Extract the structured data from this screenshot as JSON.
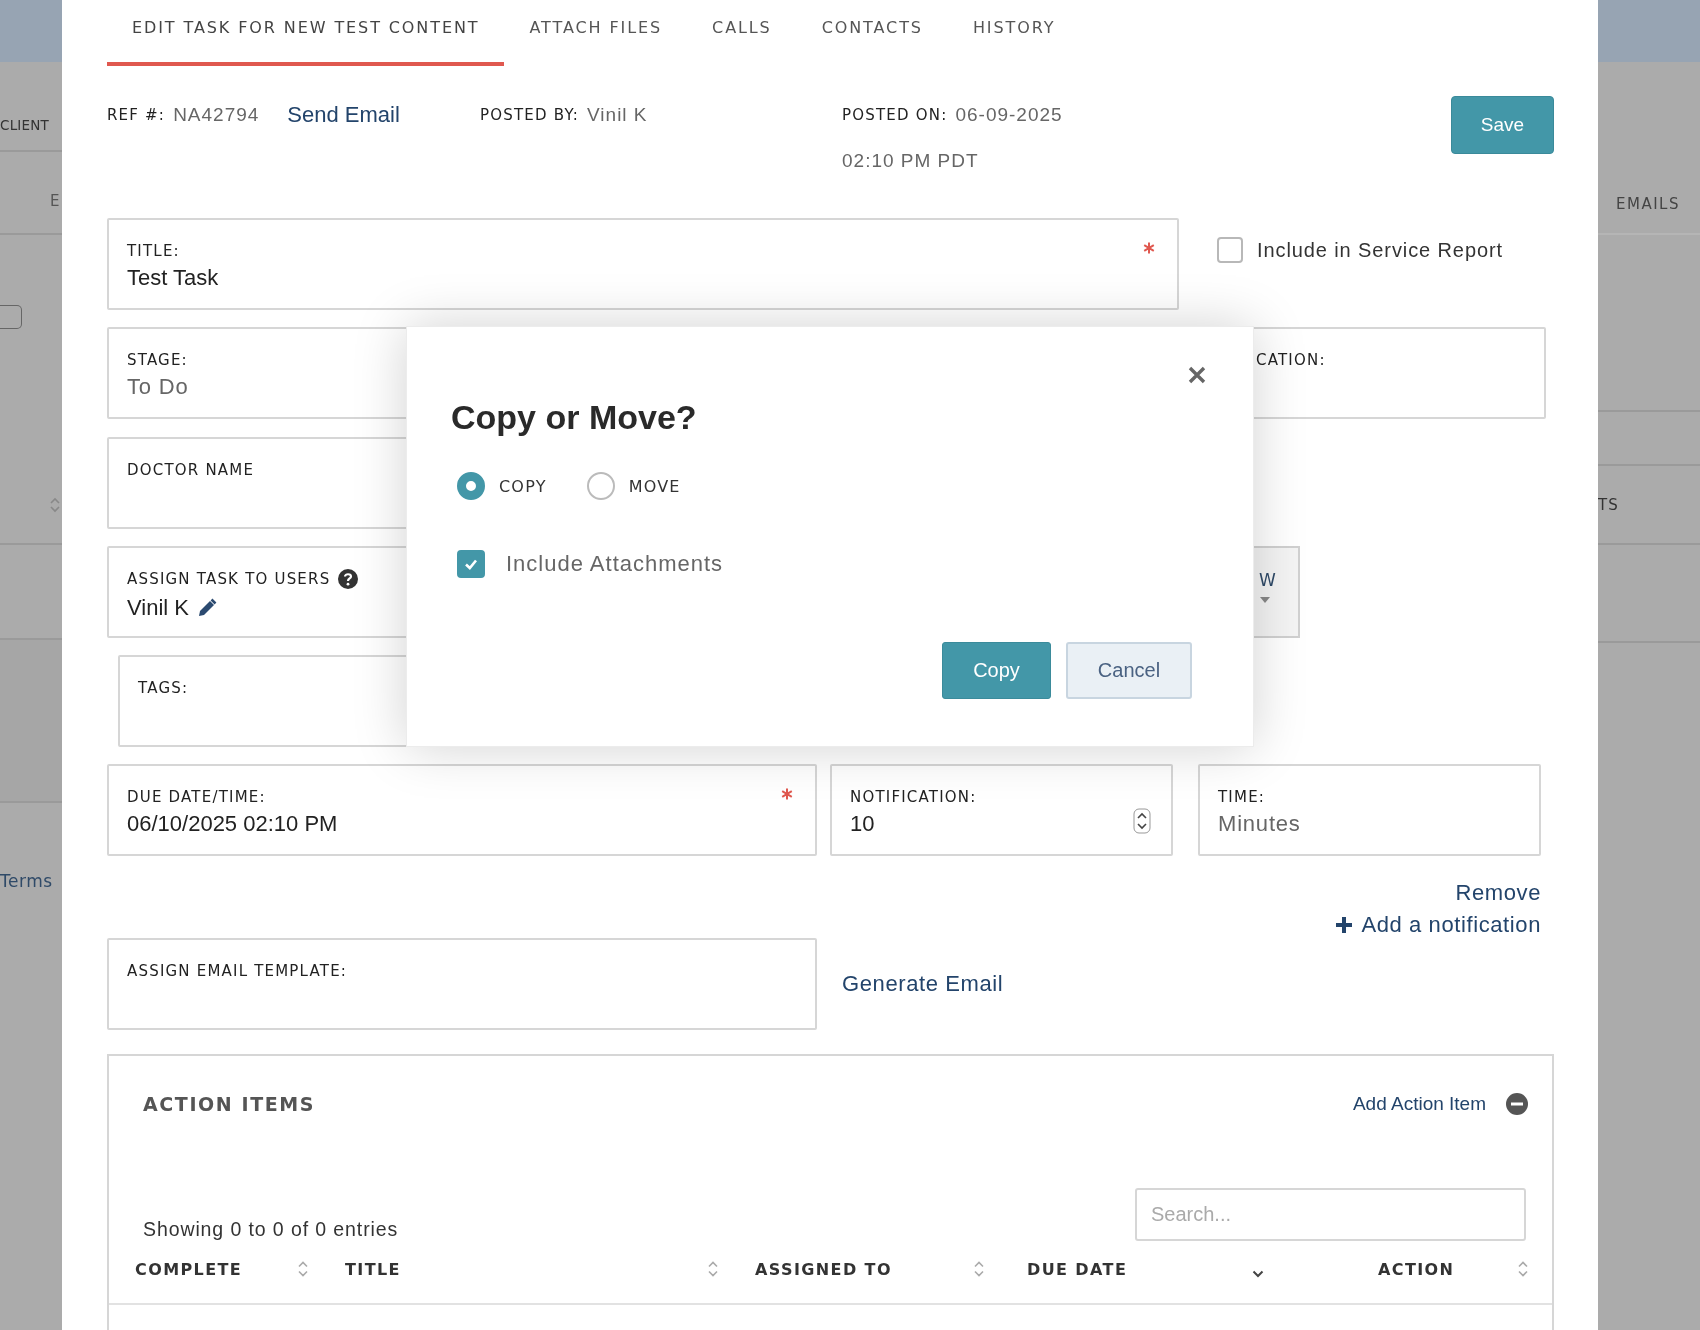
{
  "background_left": {
    "heading": "CLIENT",
    "tab": "E",
    "link": "Terms",
    "checked": false
  },
  "background_right": {
    "tab": "EMAILS",
    "heading": "TS"
  },
  "tabs": [
    {
      "label": "EDIT TASK FOR NEW TEST CONTENT",
      "selected": true
    },
    {
      "label": "ATTACH FILES",
      "selected": false
    },
    {
      "label": "CALLS",
      "selected": false
    },
    {
      "label": "CONTACTS",
      "selected": false
    },
    {
      "label": "HISTORY",
      "selected": false
    }
  ],
  "meta": {
    "ref_label": "REF #:",
    "ref_value": "NA42794",
    "send_email": "Send Email",
    "posted_by_label": "POSTED BY:",
    "posted_by": "Vinil K",
    "posted_on_label": "POSTED ON:",
    "posted_on_date": "06-09-2025",
    "posted_on_time": "02:10 PM PDT"
  },
  "save_button": "Save",
  "title_field": {
    "label": "TITLE:",
    "value": "Test Task",
    "required": true
  },
  "service_report": {
    "label": "Include in Service Report",
    "checked": false
  },
  "stage_field": {
    "label": "STAGE:",
    "value": "To Do"
  },
  "location_field": {
    "label": "CATION:"
  },
  "doctor_field": {
    "label": "DOCTOR NAME"
  },
  "assign_users_field": {
    "label": "ASSIGN TASK TO USERS",
    "value": "Vinil K"
  },
  "dropdown_fragment": {
    "value": "W"
  },
  "tags_field": {
    "label": "TAGS:"
  },
  "due_field": {
    "label": "DUE DATE/TIME:",
    "value": "06/10/2025 02:10 PM",
    "required": true
  },
  "notification_field": {
    "label": "NOTIFICATION:",
    "value": "10"
  },
  "time_field": {
    "label": "TIME:",
    "value": "Minutes"
  },
  "remove_link": "Remove",
  "add_notification": "Add a notification",
  "email_template_field": {
    "label": "ASSIGN EMAIL TEMPLATE:"
  },
  "generate_email": "Generate Email",
  "action_items": {
    "title": "ACTION ITEMS",
    "add_link": "Add Action Item",
    "search": {
      "placeholder": "Search..."
    },
    "info": "Showing 0 to 0 of 0 entries",
    "columns": [
      {
        "label": "COMPLETE",
        "sorted_descending": false
      },
      {
        "label": "TITLE",
        "sorted_descending": false
      },
      {
        "label": "ASSIGNED TO",
        "sorted_descending": false
      },
      {
        "label": "DUE DATE",
        "sorted_descending": true
      },
      {
        "label": "ACTION",
        "sorted_descending": false
      }
    ]
  },
  "modal": {
    "title": "Copy or Move?",
    "options": [
      {
        "label": "COPY",
        "selected": true
      },
      {
        "label": "MOVE",
        "selected": false
      }
    ],
    "include_attachments": {
      "label": "Include Attachments",
      "checked": true
    },
    "buttons": [
      {
        "label": "Copy",
        "kind": "primary"
      },
      {
        "label": "Cancel",
        "kind": "secondary"
      }
    ]
  }
}
